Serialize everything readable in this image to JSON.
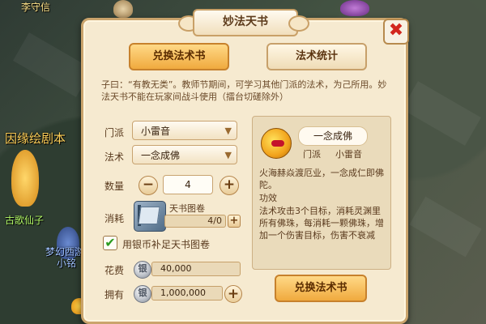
{
  "world": {
    "labels": [
      "因缘绘剧本",
      "古歌仙子",
      "梦幻西游",
      "小铭",
      "李守信"
    ]
  },
  "dialog": {
    "title": "妙法天书",
    "close_symbol": "✖",
    "tabs": [
      {
        "label": "兑换法术书",
        "active": true
      },
      {
        "label": "法术统计",
        "active": false
      }
    ],
    "description": "子曰：“有教无类”。教师节期间，可学习其他门派的法术，为己所用。妙法天书不能在玩家间战斗使用（擂台切磋除外）",
    "form": {
      "school_label": "门派",
      "school_value": "小雷音",
      "spell_label": "法术",
      "spell_value": "一念成佛",
      "qty_label": "数量",
      "qty_value": "4",
      "minus_symbol": "−",
      "plus_symbol": "+",
      "cost_label": "消耗",
      "item_name": "天书图卷",
      "item_count": "4/0",
      "checkbox_checked": true,
      "checkbox_label": "用银币补足天书图卷",
      "fee_label": "花费",
      "fee_value": "40,000",
      "own_label": "拥有",
      "own_value": "1,000,000"
    },
    "skill": {
      "name": "一念成佛",
      "school_label": "门派",
      "school_value": "小雷音",
      "lines": [
        "火海赫焱渡厄业，一念成仁即佛陀。",
        "功效",
        "法术攻击3个目标，消耗灵渊里所有佛珠，每消耗一颗佛珠，增加一个伤害目标，伤害不衰减"
      ]
    },
    "exchange_button": "兑换法术书"
  },
  "colors": {
    "accent": "#f0aa3e",
    "panel_bg": "#f6ead0",
    "border": "#caa46c",
    "close_red": "#d2261d",
    "check_green": "#2b9b21"
  }
}
